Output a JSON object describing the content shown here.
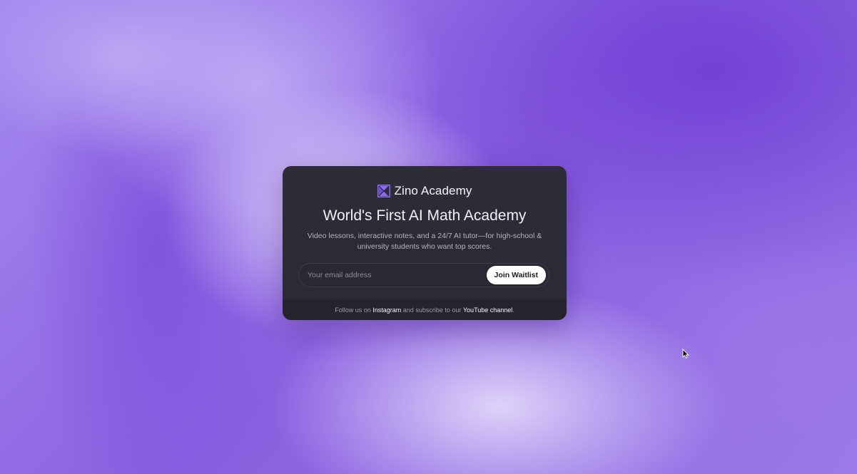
{
  "brand": {
    "name_strong": "Zino",
    "name_light": "Academy",
    "icon": "zino-logo-icon",
    "accent_color": "#8b6cf0"
  },
  "hero": {
    "headline": "World's First AI Math Academy",
    "subtitle": "Video lessons, interactive notes, and a 24/7 AI tutor—for high-school & university students who want top scores."
  },
  "waitlist": {
    "email_placeholder": "Your email address",
    "email_value": "",
    "button_label": "Join Waitlist"
  },
  "footer": {
    "text_1": "Follow us on ",
    "instagram_label": "Instagram",
    "text_2": " and subscribe to our ",
    "youtube_label": "YouTube channel",
    "text_3": "."
  },
  "colors": {
    "background_primary": "#8a5fe0",
    "card_background": "#2f2c3a",
    "button_background": "#ffffff"
  }
}
